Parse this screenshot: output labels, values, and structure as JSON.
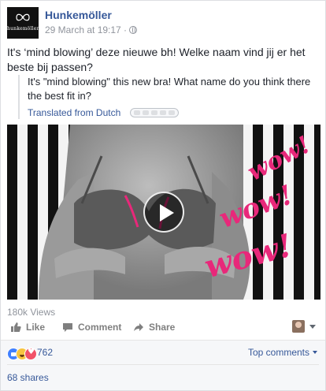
{
  "header": {
    "page_name": "Hunkemöller",
    "logo_wordmark": "hunkemöller",
    "timestamp": "29 March at 19:17 ·",
    "privacy_icon": "globe-icon"
  },
  "post": {
    "text": "It's ‘mind blowing’ deze nieuwe bh! Welke naam vind jij er het beste bij passen?",
    "translation": "It's \"mind blowing\" this new bra! What name do you think there the best fit in?",
    "translated_from": "Translated from Dutch"
  },
  "video": {
    "overlay_words": [
      "wow!",
      "wow!",
      "wow!"
    ],
    "overlay_color": "#e8287a",
    "play_icon": "play-icon"
  },
  "stats": {
    "views": "180k Views",
    "reactions_count": "762",
    "shares": "68 shares"
  },
  "actions": {
    "like": "Like",
    "comment": "Comment",
    "share": "Share"
  },
  "comments_sort": {
    "label": "Top comments"
  },
  "colors": {
    "link": "#365899",
    "muted": "#90949c",
    "like": "#4080ff",
    "haha": "#f7c440",
    "love": "#f25268"
  }
}
